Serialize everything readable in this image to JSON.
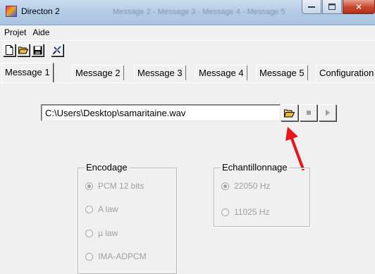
{
  "window": {
    "title": "Directon 2",
    "ghost_tabs_text": "Message 2  -  Message 3  -  Message 4  -  Message 5",
    "minimize_label": "▭",
    "maximize_label": "□",
    "close_label": "✕"
  },
  "menu": {
    "items": [
      {
        "label": "Projet"
      },
      {
        "label": "Aide"
      }
    ]
  },
  "toolbar": {
    "icons": [
      "new-file-icon",
      "open-folder-icon",
      "save-icon",
      "satellite-icon"
    ]
  },
  "tabs": [
    {
      "label": "Message 1",
      "active": true
    },
    {
      "label": "Message 2",
      "active": false
    },
    {
      "label": "Message 3",
      "active": false
    },
    {
      "label": "Message 4",
      "active": false
    },
    {
      "label": "Message 5",
      "active": false
    },
    {
      "label": "Configuration",
      "active": false
    }
  ],
  "file": {
    "path": "C:\\Users\\Desktop\\samaritaine.wav"
  },
  "controls": {
    "icons": [
      "open-folder-icon",
      "stop-icon",
      "play-icon"
    ]
  },
  "encodage": {
    "title": "Encodage",
    "options": [
      {
        "label": "PCM 12 bits",
        "checked": true
      },
      {
        "label": "A law",
        "checked": false
      },
      {
        "label": "µ law",
        "checked": false
      },
      {
        "label": "IMA-ADPCM",
        "checked": false
      }
    ]
  },
  "echantillonnage": {
    "title": "Echantillonnage",
    "options": [
      {
        "label": "22050 Hz",
        "checked": true
      },
      {
        "label": "11025 Hz",
        "checked": false
      }
    ]
  },
  "colors": {
    "titlebar": "#b5cde6",
    "window_bg": "#f0f0f0",
    "disabled_text": "#a0a0a0",
    "arrow": "#e8141b",
    "close_button": "#c7442b"
  }
}
